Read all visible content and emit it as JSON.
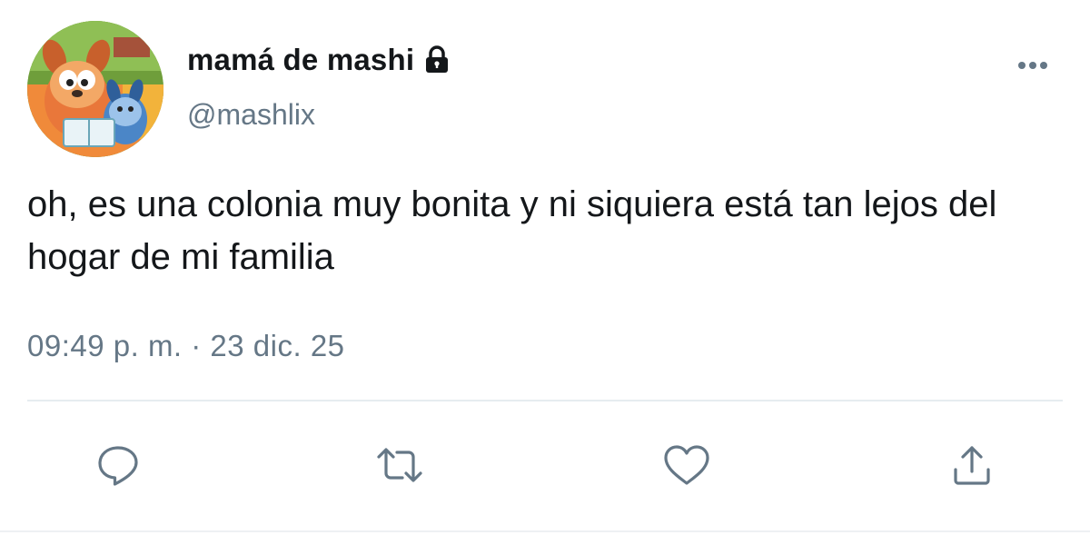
{
  "tweet": {
    "display_name": "mamá de mashi",
    "handle": "@mashlix",
    "text": "oh, es una colonia muy bonita y ni siquiera está tan lejos del hogar de mi familia",
    "timestamp": "09:49 p. m. · 23 dic. 25",
    "protected": true
  },
  "icons": {
    "lock": "lock-icon",
    "more": "more-horizontal-icon",
    "reply": "reply-icon",
    "retweet": "retweet-icon",
    "like": "heart-icon",
    "share": "share-icon"
  },
  "colors": {
    "text": "#14171a",
    "secondary": "#657786",
    "divider": "#e6ecf0"
  }
}
